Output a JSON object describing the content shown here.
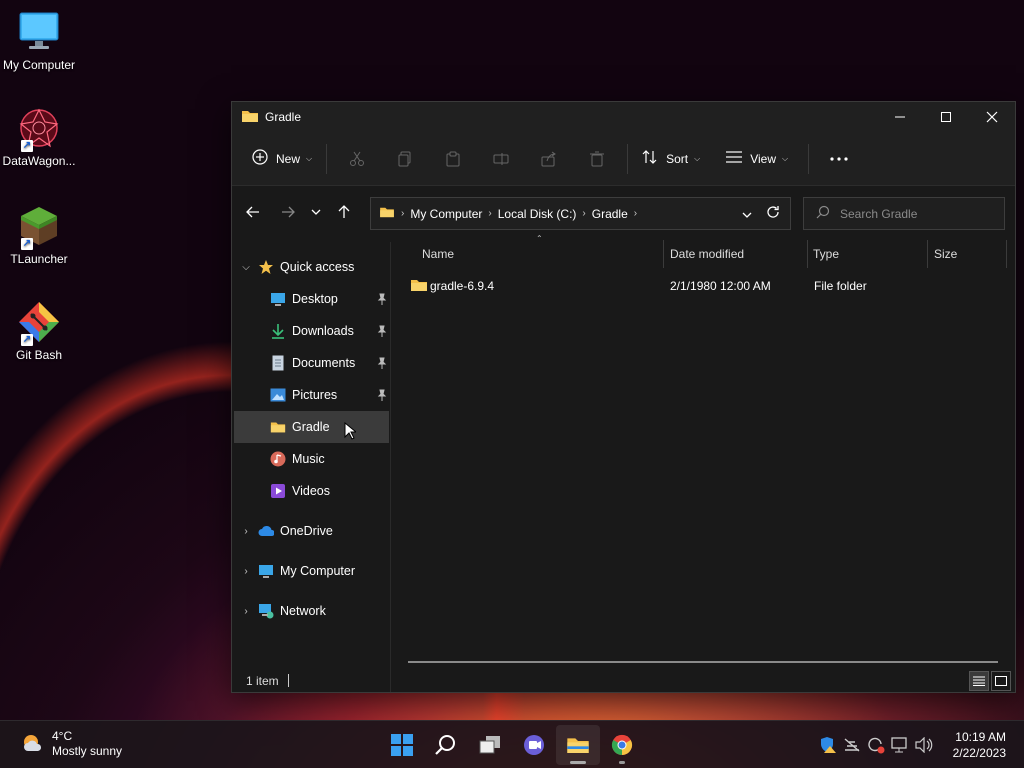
{
  "desktop": {
    "icons": [
      {
        "label": "My Computer"
      },
      {
        "label": "DataWagon..."
      },
      {
        "label": "TLauncher"
      },
      {
        "label": "Git Bash"
      }
    ]
  },
  "window": {
    "title": "Gradle",
    "toolbar": {
      "new_label": "New",
      "sort_label": "Sort",
      "view_label": "View"
    },
    "breadcrumb": [
      "My Computer",
      "Local Disk (C:)",
      "Gradle"
    ],
    "search_placeholder": "Search Gradle",
    "sidebar": {
      "quick_access": "Quick access",
      "items": [
        {
          "label": "Desktop"
        },
        {
          "label": "Downloads"
        },
        {
          "label": "Documents"
        },
        {
          "label": "Pictures"
        },
        {
          "label": "Gradle"
        },
        {
          "label": "Music"
        },
        {
          "label": "Videos"
        }
      ],
      "onedrive": "OneDrive",
      "my_computer": "My Computer",
      "network": "Network"
    },
    "columns": {
      "name": "Name",
      "date": "Date modified",
      "type": "Type",
      "size": "Size"
    },
    "files": [
      {
        "name": "gradle-6.9.4",
        "date": "2/1/1980 12:00 AM",
        "type": "File folder",
        "size": ""
      }
    ],
    "status": "1 item"
  },
  "taskbar": {
    "weather_temp": "4°C",
    "weather_desc": "Mostly sunny",
    "time": "10:19 AM",
    "date": "2/22/2023"
  }
}
